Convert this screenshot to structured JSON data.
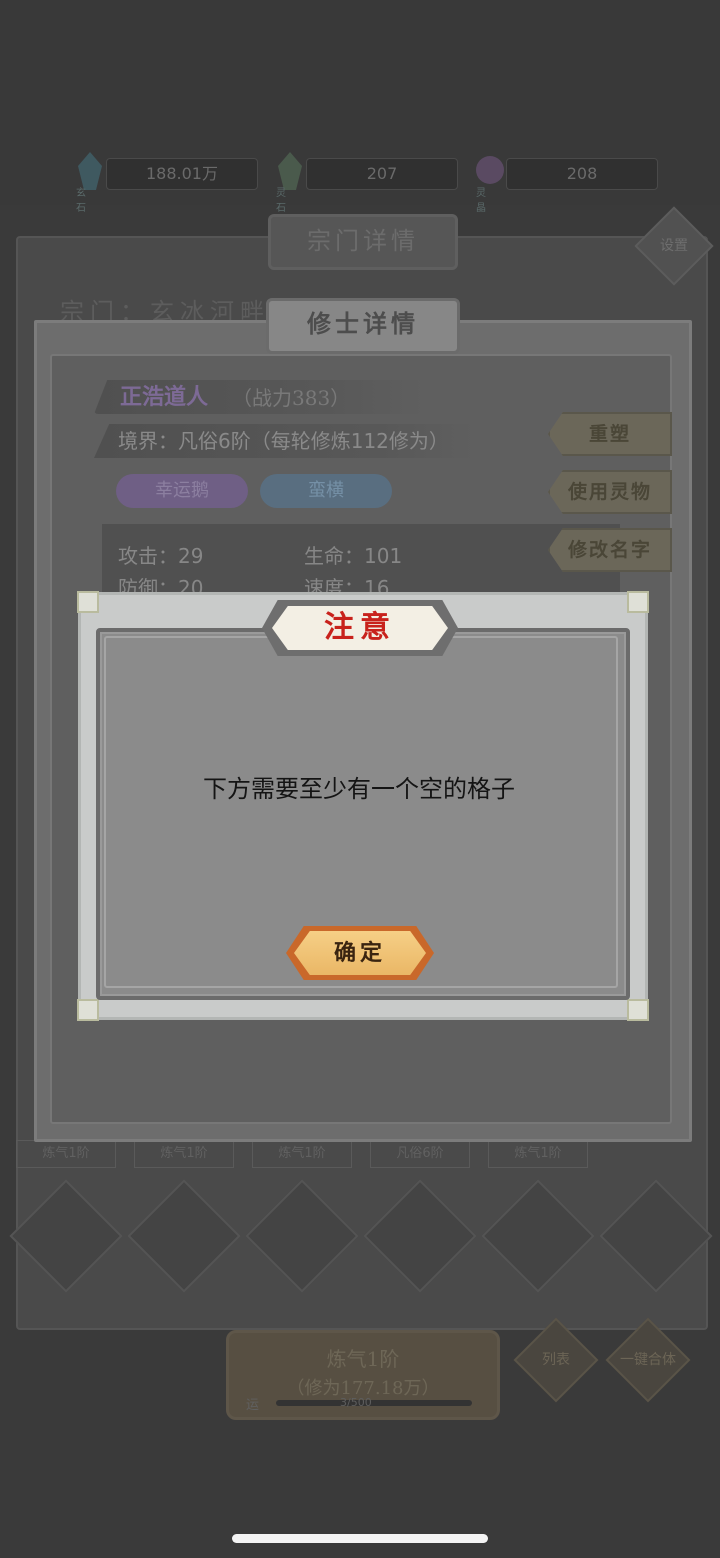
{
  "resources": [
    {
      "icon": "blue-crystal-icon",
      "value": "188.01万",
      "caption": "玄石"
    },
    {
      "icon": "green-crystal-icon",
      "value": "207",
      "caption": "灵石"
    },
    {
      "icon": "purple-orb-icon",
      "value": "208",
      "caption": "灵晶"
    }
  ],
  "sect_panel": {
    "title": "宗门详情",
    "settings_label": "设置",
    "sect_line": "宗门：玄冰河畔",
    "realm_tags": [
      "炼气1阶",
      "炼气1阶",
      "炼气1阶",
      "凡俗6阶",
      "炼气1阶"
    ],
    "main_button_line1": "炼气1阶",
    "main_button_line2": "（修为177.18万）",
    "list_label": "列表",
    "merge_label": "一键合体",
    "progress_label": "运",
    "progress_text": "3/500"
  },
  "cultivator_panel": {
    "title": "修士详情",
    "name": "正浩道人",
    "power": "（战力383）",
    "realm": "境界：凡俗6阶（每轮修炼112修为）",
    "traits": [
      "幸运鹅",
      "蛮横"
    ],
    "stats": {
      "attack": "攻击：29",
      "hp": "生命：101",
      "defense": "防御：20",
      "speed": "速度：16"
    },
    "side_buttons": [
      "重塑",
      "使用灵物",
      "修改名字"
    ]
  },
  "dialog": {
    "title": "注意",
    "message": "下方需要至少有一个空的格子",
    "confirm_label": "确定"
  },
  "colors": {
    "dialog_title": "#c8221c",
    "confirm_button": "#eab766",
    "overlay": "#3a3a3a"
  }
}
